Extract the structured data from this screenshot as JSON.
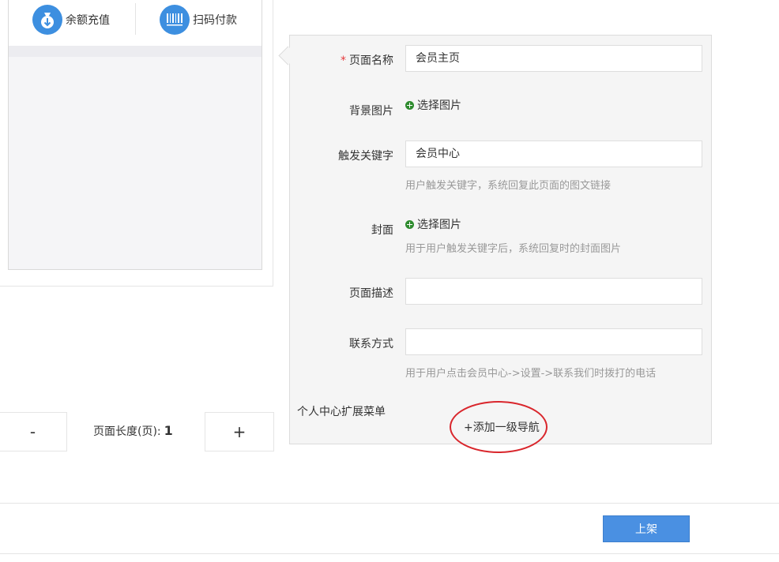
{
  "preview": {
    "quick_items": [
      {
        "label": "余额充值",
        "icon": "money-bag-icon"
      },
      {
        "label": "扫码付款",
        "icon": "barcode-icon"
      }
    ]
  },
  "page_length": {
    "minus_label": "-",
    "label": "页面长度(页):",
    "value": "1",
    "plus_label": "+"
  },
  "form": {
    "page_name": {
      "label": "页面名称",
      "required_mark": "*",
      "value": "会员主页"
    },
    "background": {
      "label": "背景图片",
      "pick_label": "选择图片"
    },
    "keyword": {
      "label": "触发关键字",
      "value": "会员中心",
      "hint": "用户触发关键字，系统回复此页面的图文链接"
    },
    "cover": {
      "label": "封面",
      "pick_label": "选择图片",
      "hint": "用于用户触发关键字后，系统回复时的封面图片"
    },
    "description": {
      "label": "页面描述",
      "value": ""
    },
    "contact": {
      "label": "联系方式",
      "value": "",
      "hint": "用于用户点击会员中心->设置->联系我们时拨打的电话"
    },
    "extension_menu": {
      "label": "个人中心扩展菜单",
      "add_label": "+添加一级导航"
    }
  },
  "footer": {
    "publish_label": "上架"
  },
  "colors": {
    "accent": "#4a90e2",
    "icon_blue": "#3d8fe0",
    "highlight_red": "#d9262c",
    "pick_green": "#2e8b2e"
  }
}
